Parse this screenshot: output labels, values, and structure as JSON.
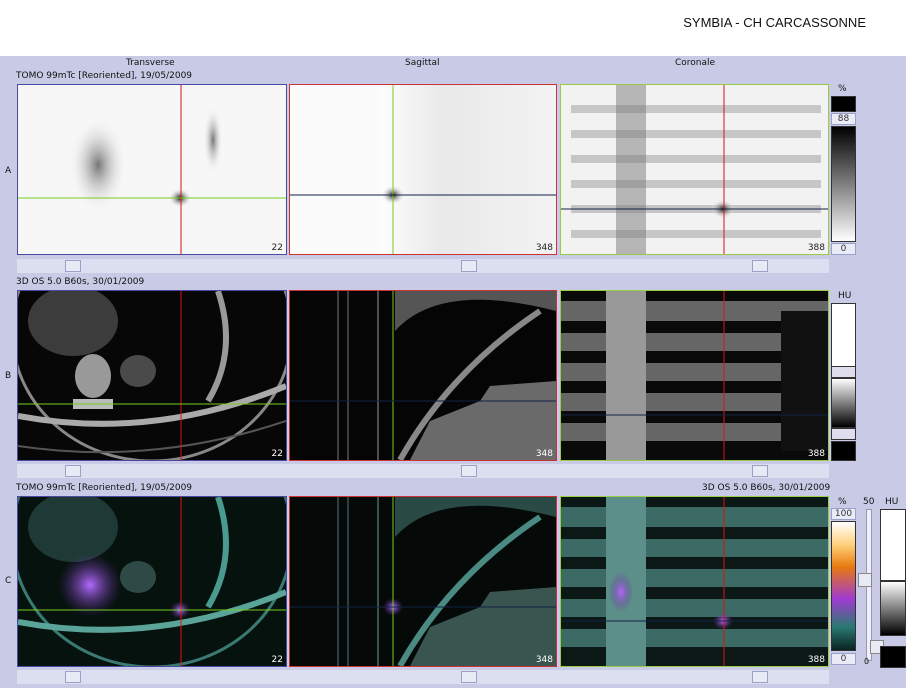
{
  "app": {
    "title": "SYMBIA - CH CARCASSONNE"
  },
  "columns": [
    "Transverse",
    "Sagittal",
    "Coronale"
  ],
  "rows": {
    "a": {
      "label": "A",
      "series": "TOMO 99mTc [Reoriented], 19/05/2009",
      "unit": "%",
      "max": "88",
      "min": "0"
    },
    "b": {
      "label": "B",
      "series": "3D  OS  5.0  B60s, 30/01/2009",
      "unit": "HU"
    },
    "c": {
      "label": "C",
      "series_left": "TOMO 99mTc [Reoriented], 19/05/2009",
      "series_right": "3D  OS  5.0  B60s, 30/01/2009",
      "unit": "%",
      "max": "100",
      "min": "0",
      "mix": "50",
      "mix_min": "0",
      "unit2": "HU"
    }
  },
  "frames": {
    "transverse": "22",
    "sagittal": "348",
    "coronale": "388"
  },
  "colors": {
    "background": "#c9cbe6",
    "crosshair_red": "#d11",
    "crosshair_green": "#7c2",
    "crosshair_blue": "#124"
  }
}
